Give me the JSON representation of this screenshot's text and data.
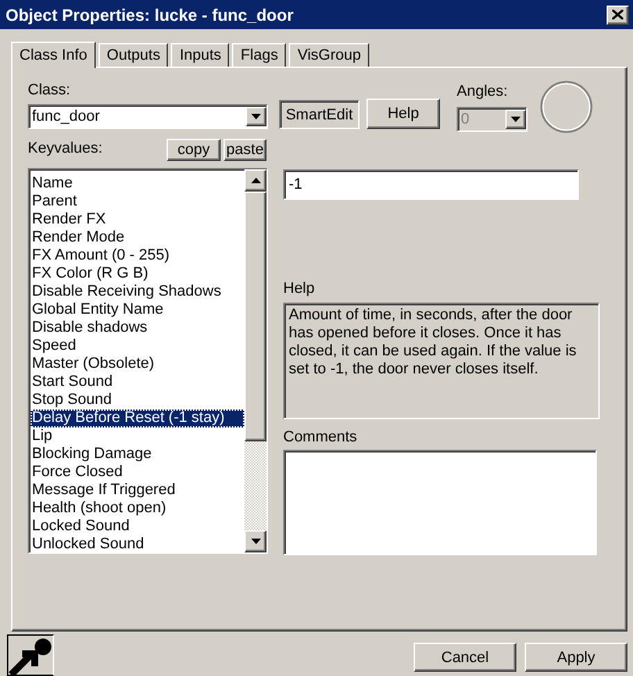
{
  "window": {
    "title": "Object Properties: lucke - func_door"
  },
  "tabs": [
    {
      "label": "Class Info",
      "selected": true
    },
    {
      "label": "Outputs",
      "selected": false
    },
    {
      "label": "Inputs",
      "selected": false
    },
    {
      "label": "Flags",
      "selected": false
    },
    {
      "label": "VisGroup",
      "selected": false
    }
  ],
  "class": {
    "label": "Class:",
    "value": "func_door"
  },
  "smartedit_button": {
    "label": "SmartEdit",
    "pressed": true
  },
  "help_button": {
    "label": "Help"
  },
  "angles": {
    "label": "Angles:",
    "value": "0",
    "disabled": true
  },
  "keyvalues": {
    "label": "Keyvalues:",
    "copy_button": "copy",
    "paste_button": "paste",
    "items": [
      {
        "label": "Name",
        "selected": false
      },
      {
        "label": "Parent",
        "selected": false
      },
      {
        "label": "Render FX",
        "selected": false
      },
      {
        "label": "Render Mode",
        "selected": false
      },
      {
        "label": "FX Amount (0 - 255)",
        "selected": false
      },
      {
        "label": "FX Color (R G B)",
        "selected": false
      },
      {
        "label": "Disable Receiving Shadows",
        "selected": false
      },
      {
        "label": "Global Entity Name",
        "selected": false
      },
      {
        "label": "Disable shadows",
        "selected": false
      },
      {
        "label": "Speed",
        "selected": false
      },
      {
        "label": "Master (Obsolete)",
        "selected": false
      },
      {
        "label": "Start Sound",
        "selected": false
      },
      {
        "label": "Stop Sound",
        "selected": false
      },
      {
        "label": "Delay Before Reset (-1 stay)",
        "selected": true
      },
      {
        "label": "Lip",
        "selected": false
      },
      {
        "label": "Blocking Damage",
        "selected": false
      },
      {
        "label": "Force Closed",
        "selected": false
      },
      {
        "label": "Message If Triggered",
        "selected": false
      },
      {
        "label": "Health (shoot open)",
        "selected": false
      },
      {
        "label": "Locked Sound",
        "selected": false
      },
      {
        "label": "Unlocked Sound",
        "selected": false
      }
    ]
  },
  "value_field": {
    "value": "-1"
  },
  "help": {
    "label": "Help",
    "text": "Amount of time, in seconds, after the door has opened before it closes. Once it has closed, it can be used again. If the value is set to -1, the door never closes itself."
  },
  "comments": {
    "label": "Comments"
  },
  "footer_buttons": [
    "Cancel",
    "Apply"
  ]
}
